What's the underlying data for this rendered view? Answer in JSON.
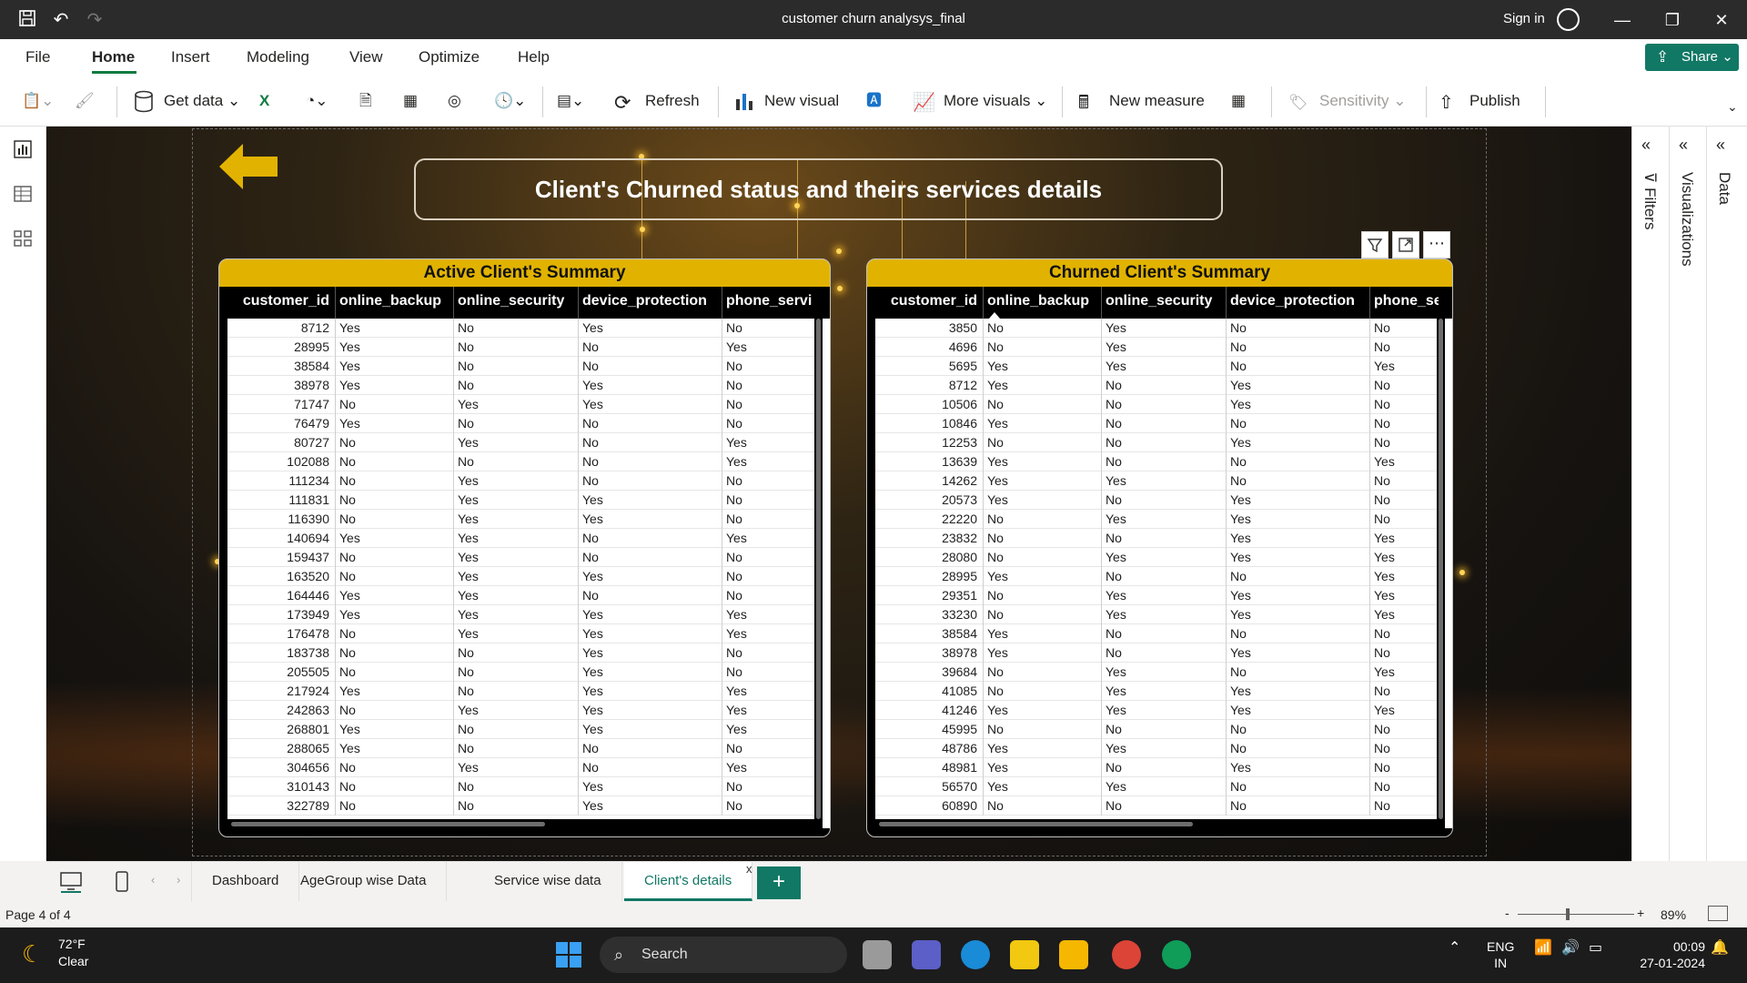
{
  "window": {
    "title": "customer churn analysys_final",
    "sign_in": "Sign in"
  },
  "menu": {
    "items": [
      "File",
      "Home",
      "Insert",
      "Modeling",
      "View",
      "Optimize",
      "Help"
    ],
    "active": "Home",
    "share": "Share"
  },
  "ribbon": {
    "get_data": "Get data",
    "refresh": "Refresh",
    "new_visual": "New visual",
    "more_visuals": "More visuals",
    "new_measure": "New measure",
    "sensitivity": "Sensitivity",
    "publish": "Publish"
  },
  "report": {
    "title": "Client's Churned status and theirs services details",
    "colors": {
      "accent": "#e1b300",
      "header_bg": "#000000"
    }
  },
  "active_table": {
    "title": "Active Client's Summary",
    "columns": [
      "customer_id",
      "online_backup",
      "online_security",
      "device_protection",
      "phone_servi"
    ],
    "rows": [
      [
        "8712",
        "Yes",
        "No",
        "Yes",
        "No"
      ],
      [
        "28995",
        "Yes",
        "No",
        "No",
        "Yes"
      ],
      [
        "38584",
        "Yes",
        "No",
        "No",
        "No"
      ],
      [
        "38978",
        "Yes",
        "No",
        "Yes",
        "No"
      ],
      [
        "71747",
        "No",
        "Yes",
        "Yes",
        "No"
      ],
      [
        "76479",
        "Yes",
        "No",
        "No",
        "No"
      ],
      [
        "80727",
        "No",
        "Yes",
        "No",
        "Yes"
      ],
      [
        "102088",
        "No",
        "No",
        "No",
        "Yes"
      ],
      [
        "111234",
        "No",
        "Yes",
        "No",
        "No"
      ],
      [
        "111831",
        "No",
        "Yes",
        "Yes",
        "No"
      ],
      [
        "116390",
        "No",
        "Yes",
        "Yes",
        "No"
      ],
      [
        "140694",
        "Yes",
        "Yes",
        "No",
        "Yes"
      ],
      [
        "159437",
        "No",
        "Yes",
        "No",
        "No"
      ],
      [
        "163520",
        "No",
        "Yes",
        "Yes",
        "No"
      ],
      [
        "164446",
        "Yes",
        "Yes",
        "No",
        "No"
      ],
      [
        "173949",
        "Yes",
        "Yes",
        "Yes",
        "Yes"
      ],
      [
        "176478",
        "No",
        "Yes",
        "Yes",
        "Yes"
      ],
      [
        "183738",
        "No",
        "No",
        "Yes",
        "No"
      ],
      [
        "205505",
        "No",
        "No",
        "Yes",
        "No"
      ],
      [
        "217924",
        "Yes",
        "No",
        "Yes",
        "Yes"
      ],
      [
        "242863",
        "No",
        "Yes",
        "Yes",
        "Yes"
      ],
      [
        "268801",
        "Yes",
        "No",
        "Yes",
        "Yes"
      ],
      [
        "288065",
        "Yes",
        "No",
        "No",
        "No"
      ],
      [
        "304656",
        "No",
        "Yes",
        "No",
        "Yes"
      ],
      [
        "310143",
        "No",
        "No",
        "Yes",
        "No"
      ],
      [
        "322789",
        "No",
        "No",
        "Yes",
        "No"
      ]
    ]
  },
  "churned_table": {
    "title": "Churned Client's Summary",
    "columns": [
      "customer_id",
      "online_backup",
      "online_security",
      "device_protection",
      "phone_se"
    ],
    "rows": [
      [
        "3850",
        "No",
        "Yes",
        "No",
        "No"
      ],
      [
        "4696",
        "No",
        "Yes",
        "No",
        "No"
      ],
      [
        "5695",
        "Yes",
        "Yes",
        "No",
        "Yes"
      ],
      [
        "8712",
        "Yes",
        "No",
        "Yes",
        "No"
      ],
      [
        "10506",
        "No",
        "No",
        "Yes",
        "No"
      ],
      [
        "10846",
        "Yes",
        "No",
        "No",
        "No"
      ],
      [
        "12253",
        "No",
        "No",
        "Yes",
        "No"
      ],
      [
        "13639",
        "Yes",
        "No",
        "No",
        "Yes"
      ],
      [
        "14262",
        "Yes",
        "Yes",
        "No",
        "No"
      ],
      [
        "20573",
        "Yes",
        "No",
        "Yes",
        "No"
      ],
      [
        "22220",
        "No",
        "Yes",
        "Yes",
        "No"
      ],
      [
        "23832",
        "No",
        "No",
        "Yes",
        "Yes"
      ],
      [
        "28080",
        "No",
        "Yes",
        "Yes",
        "Yes"
      ],
      [
        "28995",
        "Yes",
        "No",
        "No",
        "Yes"
      ],
      [
        "29351",
        "No",
        "Yes",
        "Yes",
        "Yes"
      ],
      [
        "33230",
        "No",
        "Yes",
        "Yes",
        "Yes"
      ],
      [
        "38584",
        "Yes",
        "No",
        "No",
        "No"
      ],
      [
        "38978",
        "Yes",
        "No",
        "Yes",
        "No"
      ],
      [
        "39684",
        "No",
        "Yes",
        "No",
        "Yes"
      ],
      [
        "41085",
        "No",
        "Yes",
        "Yes",
        "No"
      ],
      [
        "41246",
        "Yes",
        "Yes",
        "Yes",
        "Yes"
      ],
      [
        "45995",
        "No",
        "No",
        "No",
        "No"
      ],
      [
        "48786",
        "Yes",
        "Yes",
        "No",
        "No"
      ],
      [
        "48981",
        "Yes",
        "No",
        "Yes",
        "No"
      ],
      [
        "56570",
        "Yes",
        "Yes",
        "No",
        "No"
      ],
      [
        "60890",
        "No",
        "No",
        "No",
        "No"
      ]
    ]
  },
  "side_panes": {
    "filters": "Filters",
    "visualizations": "Visualizations",
    "data": "Data"
  },
  "pages": {
    "tabs": [
      "Dashboard",
      "AgeGroup wise Data",
      "Service wise data",
      "Client's details"
    ],
    "active": "Client's details",
    "add": "+",
    "close": "x"
  },
  "status": {
    "page": "Page 4 of 4",
    "zoom": "89%",
    "zoom_minus": "-",
    "zoom_plus": "+"
  },
  "taskbar": {
    "temperature": "72°F",
    "condition": "Clear",
    "search": "Search",
    "lang1": "ENG",
    "lang2": "IN",
    "time": "00:09",
    "date": "27-01-2024"
  }
}
